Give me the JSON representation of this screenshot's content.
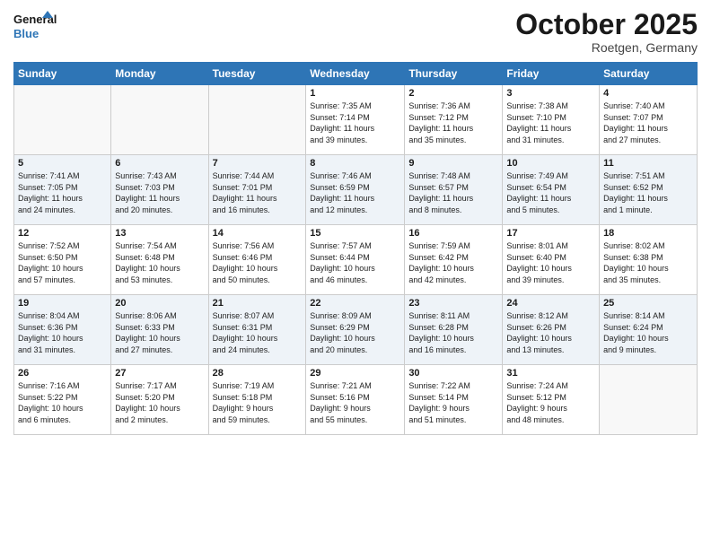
{
  "header": {
    "logo_line1": "General",
    "logo_line2": "Blue",
    "month": "October 2025",
    "location": "Roetgen, Germany"
  },
  "days_of_week": [
    "Sunday",
    "Monday",
    "Tuesday",
    "Wednesday",
    "Thursday",
    "Friday",
    "Saturday"
  ],
  "weeks": [
    [
      {
        "day": "",
        "info": ""
      },
      {
        "day": "",
        "info": ""
      },
      {
        "day": "",
        "info": ""
      },
      {
        "day": "1",
        "info": "Sunrise: 7:35 AM\nSunset: 7:14 PM\nDaylight: 11 hours\nand 39 minutes."
      },
      {
        "day": "2",
        "info": "Sunrise: 7:36 AM\nSunset: 7:12 PM\nDaylight: 11 hours\nand 35 minutes."
      },
      {
        "day": "3",
        "info": "Sunrise: 7:38 AM\nSunset: 7:10 PM\nDaylight: 11 hours\nand 31 minutes."
      },
      {
        "day": "4",
        "info": "Sunrise: 7:40 AM\nSunset: 7:07 PM\nDaylight: 11 hours\nand 27 minutes."
      }
    ],
    [
      {
        "day": "5",
        "info": "Sunrise: 7:41 AM\nSunset: 7:05 PM\nDaylight: 11 hours\nand 24 minutes."
      },
      {
        "day": "6",
        "info": "Sunrise: 7:43 AM\nSunset: 7:03 PM\nDaylight: 11 hours\nand 20 minutes."
      },
      {
        "day": "7",
        "info": "Sunrise: 7:44 AM\nSunset: 7:01 PM\nDaylight: 11 hours\nand 16 minutes."
      },
      {
        "day": "8",
        "info": "Sunrise: 7:46 AM\nSunset: 6:59 PM\nDaylight: 11 hours\nand 12 minutes."
      },
      {
        "day": "9",
        "info": "Sunrise: 7:48 AM\nSunset: 6:57 PM\nDaylight: 11 hours\nand 8 minutes."
      },
      {
        "day": "10",
        "info": "Sunrise: 7:49 AM\nSunset: 6:54 PM\nDaylight: 11 hours\nand 5 minutes."
      },
      {
        "day": "11",
        "info": "Sunrise: 7:51 AM\nSunset: 6:52 PM\nDaylight: 11 hours\nand 1 minute."
      }
    ],
    [
      {
        "day": "12",
        "info": "Sunrise: 7:52 AM\nSunset: 6:50 PM\nDaylight: 10 hours\nand 57 minutes."
      },
      {
        "day": "13",
        "info": "Sunrise: 7:54 AM\nSunset: 6:48 PM\nDaylight: 10 hours\nand 53 minutes."
      },
      {
        "day": "14",
        "info": "Sunrise: 7:56 AM\nSunset: 6:46 PM\nDaylight: 10 hours\nand 50 minutes."
      },
      {
        "day": "15",
        "info": "Sunrise: 7:57 AM\nSunset: 6:44 PM\nDaylight: 10 hours\nand 46 minutes."
      },
      {
        "day": "16",
        "info": "Sunrise: 7:59 AM\nSunset: 6:42 PM\nDaylight: 10 hours\nand 42 minutes."
      },
      {
        "day": "17",
        "info": "Sunrise: 8:01 AM\nSunset: 6:40 PM\nDaylight: 10 hours\nand 39 minutes."
      },
      {
        "day": "18",
        "info": "Sunrise: 8:02 AM\nSunset: 6:38 PM\nDaylight: 10 hours\nand 35 minutes."
      }
    ],
    [
      {
        "day": "19",
        "info": "Sunrise: 8:04 AM\nSunset: 6:36 PM\nDaylight: 10 hours\nand 31 minutes."
      },
      {
        "day": "20",
        "info": "Sunrise: 8:06 AM\nSunset: 6:33 PM\nDaylight: 10 hours\nand 27 minutes."
      },
      {
        "day": "21",
        "info": "Sunrise: 8:07 AM\nSunset: 6:31 PM\nDaylight: 10 hours\nand 24 minutes."
      },
      {
        "day": "22",
        "info": "Sunrise: 8:09 AM\nSunset: 6:29 PM\nDaylight: 10 hours\nand 20 minutes."
      },
      {
        "day": "23",
        "info": "Sunrise: 8:11 AM\nSunset: 6:28 PM\nDaylight: 10 hours\nand 16 minutes."
      },
      {
        "day": "24",
        "info": "Sunrise: 8:12 AM\nSunset: 6:26 PM\nDaylight: 10 hours\nand 13 minutes."
      },
      {
        "day": "25",
        "info": "Sunrise: 8:14 AM\nSunset: 6:24 PM\nDaylight: 10 hours\nand 9 minutes."
      }
    ],
    [
      {
        "day": "26",
        "info": "Sunrise: 7:16 AM\nSunset: 5:22 PM\nDaylight: 10 hours\nand 6 minutes."
      },
      {
        "day": "27",
        "info": "Sunrise: 7:17 AM\nSunset: 5:20 PM\nDaylight: 10 hours\nand 2 minutes."
      },
      {
        "day": "28",
        "info": "Sunrise: 7:19 AM\nSunset: 5:18 PM\nDaylight: 9 hours\nand 59 minutes."
      },
      {
        "day": "29",
        "info": "Sunrise: 7:21 AM\nSunset: 5:16 PM\nDaylight: 9 hours\nand 55 minutes."
      },
      {
        "day": "30",
        "info": "Sunrise: 7:22 AM\nSunset: 5:14 PM\nDaylight: 9 hours\nand 51 minutes."
      },
      {
        "day": "31",
        "info": "Sunrise: 7:24 AM\nSunset: 5:12 PM\nDaylight: 9 hours\nand 48 minutes."
      },
      {
        "day": "",
        "info": ""
      }
    ]
  ]
}
